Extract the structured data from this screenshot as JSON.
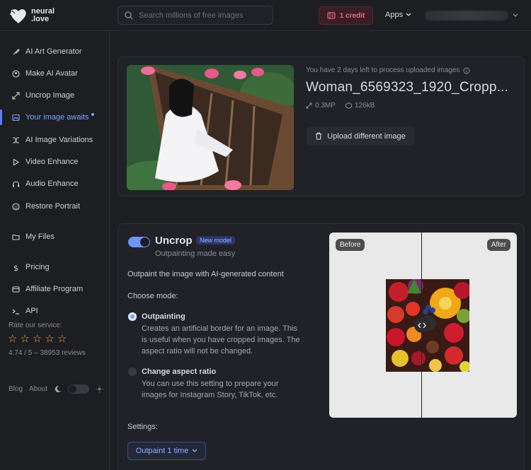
{
  "header": {
    "logo_line1": "neural",
    "logo_line2": ".love",
    "search_placeholder": "Search millions of free images",
    "credit_label": "1 credit",
    "apps_label": "Apps"
  },
  "sidebar": {
    "items": [
      {
        "label": "AI Art Generator",
        "icon": "brush-icon"
      },
      {
        "label": "Make AI Avatar",
        "icon": "avatar-icon"
      },
      {
        "label": "Uncrop Image",
        "icon": "expand-icon"
      },
      {
        "label": "Your image awaits",
        "icon": "image-icon",
        "active": true
      },
      {
        "label": "AI Image Variations",
        "icon": "shuffle-icon"
      },
      {
        "label": "Video Enhance",
        "icon": "play-icon"
      },
      {
        "label": "Audio Enhance",
        "icon": "headphones-icon"
      },
      {
        "label": "Restore Portrait",
        "icon": "face-icon"
      },
      {
        "label": "My Files",
        "icon": "folder-icon"
      },
      {
        "label": "Pricing",
        "icon": "dollar-icon"
      },
      {
        "label": "Affiliate Program",
        "icon": "card-icon"
      },
      {
        "label": "API",
        "icon": "terminal-icon"
      }
    ],
    "rate_label": "Rate our service:",
    "rating_stars": 5,
    "reviews": "4.74 / 5 – 38953 reviews",
    "blog_label": "Blog",
    "about_label": "About"
  },
  "upload_card": {
    "notice": "You have 2 days left to process uploaded images",
    "filename": "Woman_6569323_1920_Cropp...",
    "megapixels": "0.3MP",
    "filesize": "126kB",
    "upload_button": "Upload different image"
  },
  "uncrop_card": {
    "title": "Uncrop",
    "badge": "New model",
    "subtitle": "Outpainting made easy",
    "description": "Outpaint the image with AI-generated content",
    "choose_mode": "Choose mode:",
    "options": [
      {
        "title": "Outpainting",
        "lines": [
          "Creates an artificial border for an image. This",
          "is useful when you have cropped images. The",
          "aspect ratio will not be changed."
        ],
        "selected": true
      },
      {
        "title": "Change aspect ratio",
        "lines": [
          "You can use this setting to prepare your",
          "images for Instagram Story, TikTok, etc."
        ],
        "selected": false
      }
    ],
    "settings_label": "Settings:",
    "select_value": "Outpaint 1 time",
    "before_label": "Before",
    "after_label": "After"
  },
  "colors": {
    "accent": "#7ba4ff",
    "credit": "#f16b82",
    "star": "#f0a93b"
  }
}
